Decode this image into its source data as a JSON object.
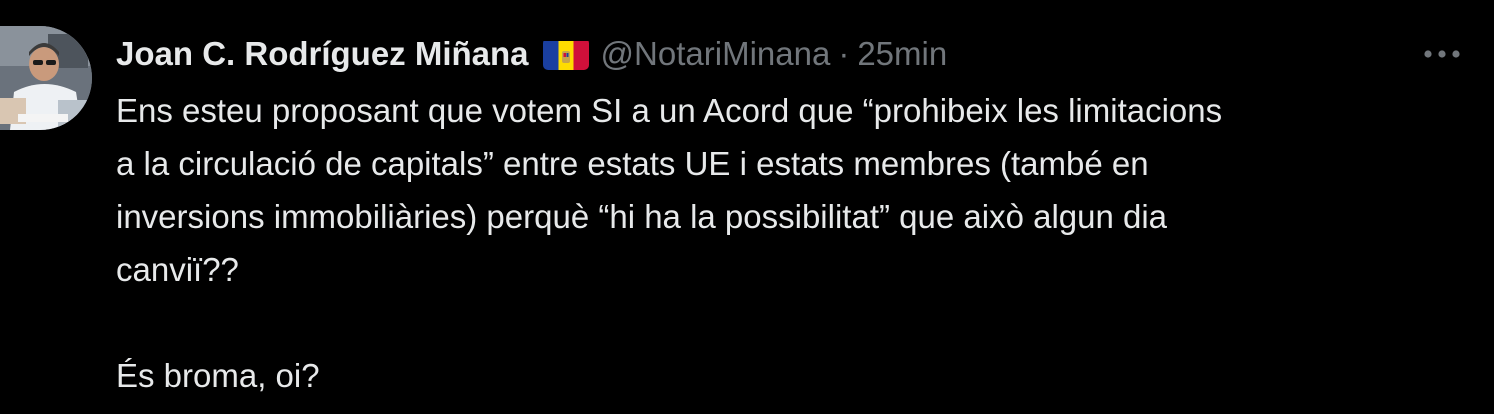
{
  "tweet": {
    "author": {
      "display_name": "Joan C. Rodríguez Miñana",
      "flag_icon": "andorra-flag-icon",
      "handle": "@NotariMinana"
    },
    "separator": "·",
    "timestamp": "25min",
    "more_icon": "more-horizontal-icon",
    "text_lines": [
      "Ens esteu proposant que votem SI a un Acord que “prohibeix les limitacions",
      "a la circulació de capitals” entre estats UE i estats membres (també en",
      "inversions immobiliàries) perquè “hi ha la possibilitat” que això algun dia",
      "canviï??",
      "",
      "És broma, oi?"
    ]
  },
  "colors": {
    "background": "#000000",
    "primary_text": "#e7e9ea",
    "secondary_text": "#71767b",
    "flag_blue": "#1a3fa0",
    "flag_yellow": "#fedd00",
    "flag_red": "#d0103a"
  }
}
